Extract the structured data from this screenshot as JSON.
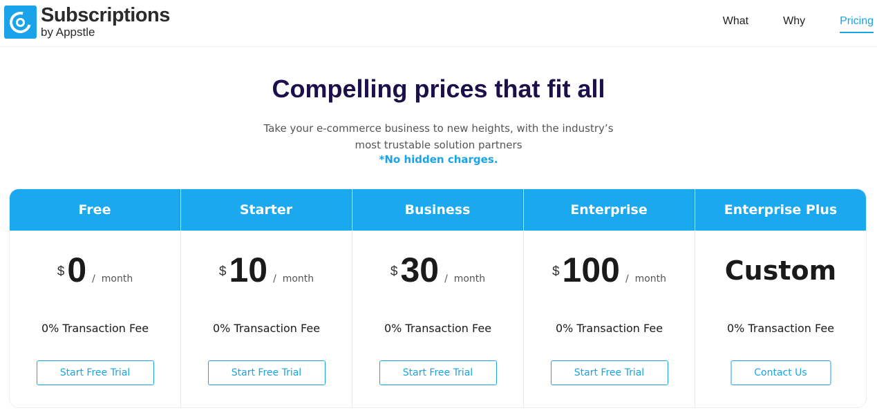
{
  "header": {
    "logo_title": "Subscriptions",
    "logo_sub": "by Appstle",
    "nav": [
      {
        "label": "What",
        "active": false
      },
      {
        "label": "Why",
        "active": false
      },
      {
        "label": "Pricing",
        "active": true
      }
    ]
  },
  "hero": {
    "title": "Compelling prices that fit all",
    "subtitle_line1": "Take your e-commerce business to new heights, with the industry’s",
    "subtitle_line2": "most trustable solution partners",
    "note": "*No hidden charges."
  },
  "colors": {
    "accent": "#1aa3e8",
    "header_blue": "#1aa8ee",
    "title_navy": "#1c0f4a"
  },
  "plans": [
    {
      "name": "Free",
      "currency": "$",
      "amount": "0",
      "period": "month",
      "fee": "0% Transaction Fee",
      "cta": "Start Free Trial"
    },
    {
      "name": "Starter",
      "currency": "$",
      "amount": "10",
      "period": "month",
      "fee": "0% Transaction Fee",
      "cta": "Start Free Trial"
    },
    {
      "name": "Business",
      "currency": "$",
      "amount": "30",
      "period": "month",
      "fee": "0% Transaction Fee",
      "cta": "Start Free Trial"
    },
    {
      "name": "Enterprise",
      "currency": "$",
      "amount": "100",
      "period": "month",
      "fee": "0% Transaction Fee",
      "cta": "Start Free Trial"
    },
    {
      "name": "Enterprise Plus",
      "custom_price": "Custom",
      "fee": "0% Transaction Fee",
      "cta": "Contact Us"
    }
  ]
}
